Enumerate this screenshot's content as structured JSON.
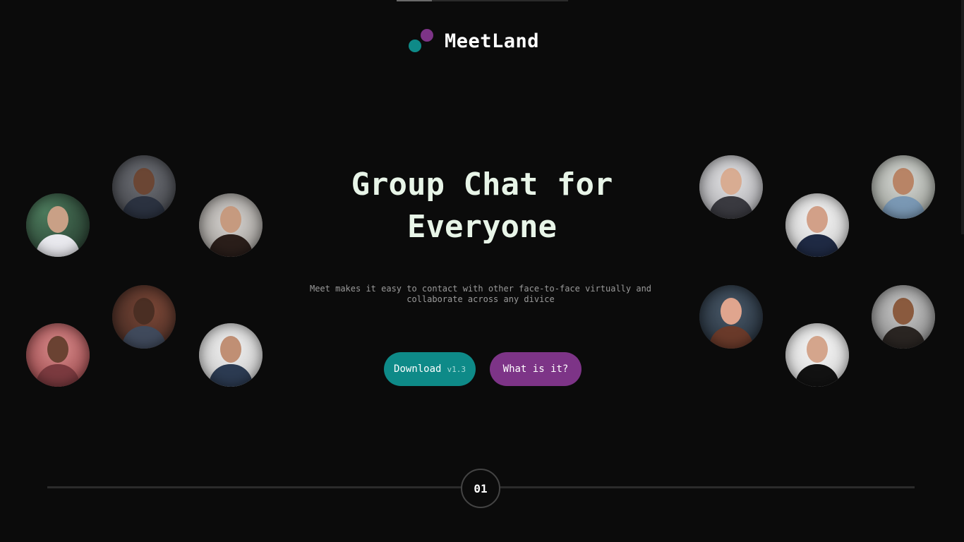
{
  "brand": {
    "name": "MeetLand"
  },
  "hero": {
    "title_line1": "Group Chat for",
    "title_line2": "Everyone",
    "subtitle_line1": "Meet makes it easy to contact with other face-to-face virtually and",
    "subtitle_line2": "collaborate across any divice"
  },
  "actions": {
    "download_label": "Download",
    "download_version": "v1.3",
    "what_label": "What is it?"
  },
  "pager": {
    "current": "01"
  },
  "colors": {
    "background": "#0b0b0b",
    "teal": "#0e8a88",
    "purple": "#7d3487",
    "title": "#e8f5e8"
  },
  "avatars": [
    {
      "name": "avatar-woman-smiling-left"
    },
    {
      "name": "avatar-bearded-older-man"
    },
    {
      "name": "avatar-woman-dark-hair"
    },
    {
      "name": "avatar-man-glasses-red-bg"
    },
    {
      "name": "avatar-man-thinking"
    },
    {
      "name": "avatar-man-bearded-casual"
    },
    {
      "name": "avatar-woman-striped-shirt"
    },
    {
      "name": "avatar-man-suit-smiling"
    },
    {
      "name": "avatar-man-glasses-beard"
    },
    {
      "name": "avatar-woman-red-lips"
    },
    {
      "name": "avatar-man-black-jacket"
    },
    {
      "name": "avatar-woman-curly-hair"
    }
  ]
}
